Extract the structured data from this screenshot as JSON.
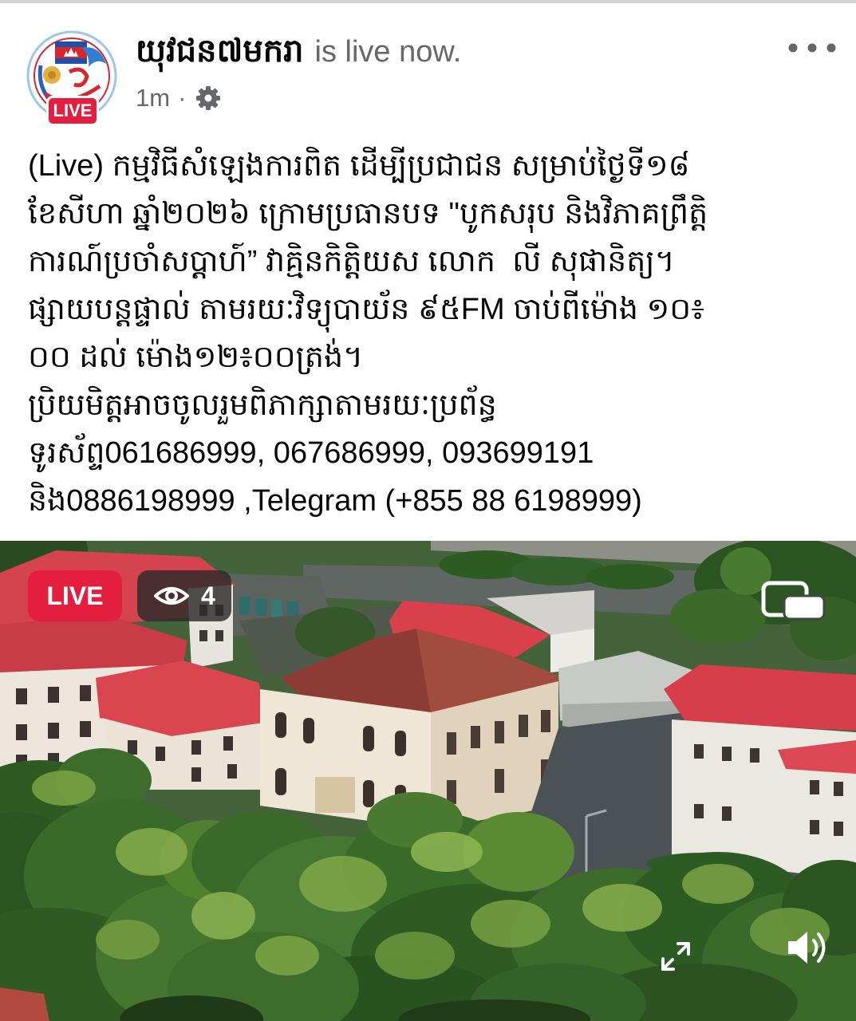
{
  "post_header": {
    "page_name": "យុវជន៧មករា",
    "status_text": "is live now.",
    "timestamp": "1m",
    "separator": "·",
    "avatar_badge": "LIVE",
    "audience_icon": "gear-icon",
    "more_icon": "more-options-icon"
  },
  "post_body": {
    "lines": [
      "(Live) កម្មវិធីសំឡេងការពិត ដើម្បីប្រជាជន សម្រាប់ថ្ងៃទី១៨",
      "ខែសីហា ឆ្នាំ២០២៦ ក្រោមប្រធានបទ \"បូកសរុប និងវិភាគព្រឹត្តិ",
      "ការណ៍ប្រចាំសប្តាហ៍” វាគ្មិនកិត្តិយស លោក  លី សុផានិត្យ។",
      "ផ្សាយបន្តផ្ទាល់ តាមរយៈវិទ្យុបាយ័ន ៩៥FM ចាប់ពីម៉ោង ១០៖",
      "០០ ដល់ ម៉ោង១២៖០០ត្រង់។",
      "ប្រិយមិត្តអាចចូលរួមពិភាក្សាតាមរយៈប្រព័ន្ធ",
      "ទូរស័ព្ទ061686999, 067686999, 093699191",
      "និង0886198999 ,Telegram (+855 88 6198999)"
    ]
  },
  "video": {
    "live_label": "LIVE",
    "viewer_count": "4",
    "viewer_icon": "eye-icon",
    "pip_icon": "picture-in-picture-icon",
    "fullscreen_icon": "expand-icon",
    "sound_icon": "speaker-icon"
  },
  "colors": {
    "live_red": "#e41e3f",
    "text_primary": "#050505",
    "text_secondary": "#65676b"
  }
}
